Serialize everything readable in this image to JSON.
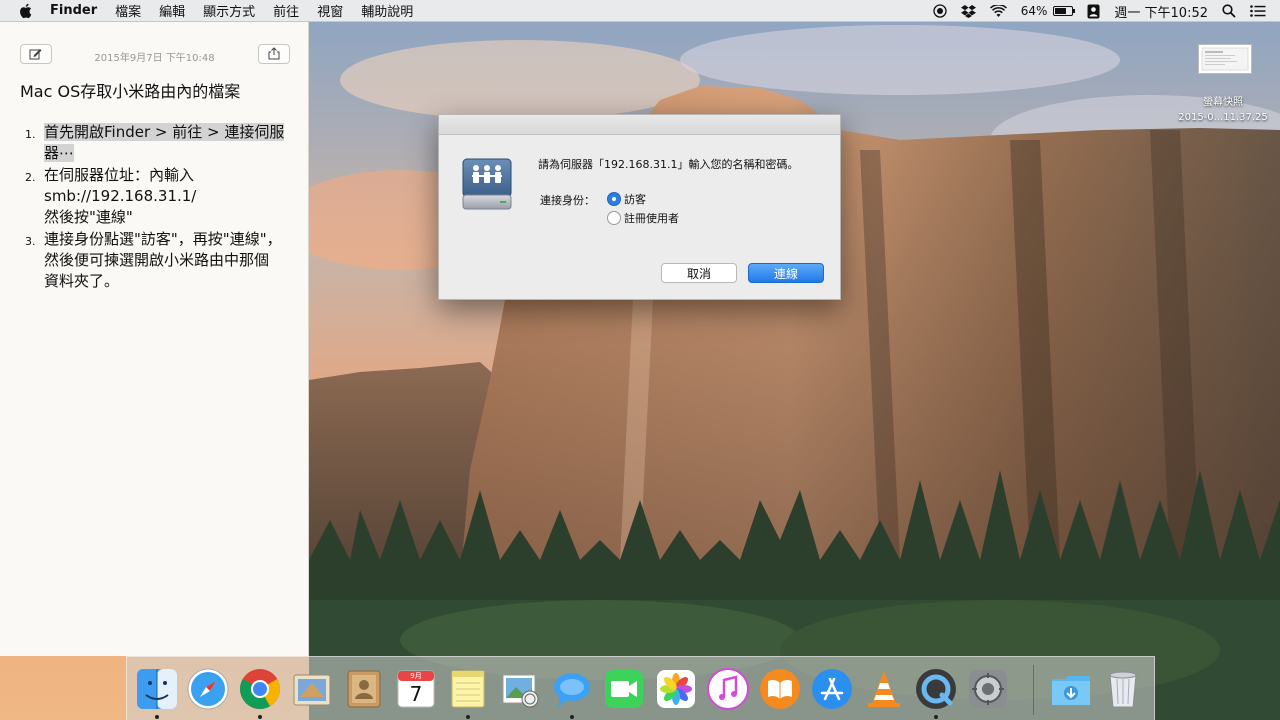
{
  "menubar": {
    "apple_icon": "apple-icon",
    "app_name": "Finder",
    "items": [
      "檔案",
      "編輯",
      "顯示方式",
      "前往",
      "視窗",
      "輔助說明"
    ],
    "battery_pct": "64%",
    "datetime": "週一 下午10:52"
  },
  "notes": {
    "date": "2015年9月7日 下午10:48",
    "title": "Mac OS存取小米路由內的檔案",
    "items": [
      {
        "num": "1.",
        "text": "首先開啟Finder > 前往 > 連接伺服器⋯"
      },
      {
        "num": "2.",
        "text_line1": "在伺服器位址：內輸入",
        "text_line2": "smb://192.168.31.1/",
        "text_line3": "然後按\"連線\""
      },
      {
        "num": "3.",
        "text_line1": "連接身份點選\"訪客\"，再按\"連線\"，",
        "text_line2": "然後便可揀選開啟小米路由中那個",
        "text_line3": "資料夾了。"
      }
    ]
  },
  "dialog": {
    "prompt": "請為伺服器「192.168.31.1」輸入您的名稱和密碼。",
    "connect_as_label": "連接身份：",
    "options": [
      {
        "label": "訪客",
        "selected": true
      },
      {
        "label": "註冊使用者",
        "selected": false
      }
    ],
    "cancel_label": "取消",
    "connect_label": "連線"
  },
  "desktop": {
    "screenshot_label_line1": "螢幕快照",
    "screenshot_label_line2": "2015-0...11.37.25"
  },
  "dock": {
    "items": [
      {
        "name": "finder-icon",
        "running": true
      },
      {
        "name": "safari-icon",
        "running": false
      },
      {
        "name": "chrome-icon",
        "running": true
      },
      {
        "name": "mail-icon",
        "running": false
      },
      {
        "name": "contacts-icon",
        "running": false
      },
      {
        "name": "calendar-icon",
        "running": false,
        "month": "9月",
        "day": "7"
      },
      {
        "name": "notes-icon",
        "running": true
      },
      {
        "name": "preview-icon",
        "running": false
      },
      {
        "name": "messages-icon",
        "running": true
      },
      {
        "name": "facetime-icon",
        "running": false
      },
      {
        "name": "photos-icon",
        "running": false
      },
      {
        "name": "itunes-icon",
        "running": false
      },
      {
        "name": "ibooks-icon",
        "running": false
      },
      {
        "name": "appstore-icon",
        "running": false
      },
      {
        "name": "vlc-icon",
        "running": false
      },
      {
        "name": "quicktime-icon",
        "running": true
      },
      {
        "name": "system-preferences-icon",
        "running": false
      },
      {
        "name": "downloads-folder-icon",
        "running": false
      },
      {
        "name": "trash-icon",
        "running": false
      }
    ]
  },
  "colors": {
    "accent": "#2a7ee0",
    "highlight": "#d3d3d3"
  }
}
